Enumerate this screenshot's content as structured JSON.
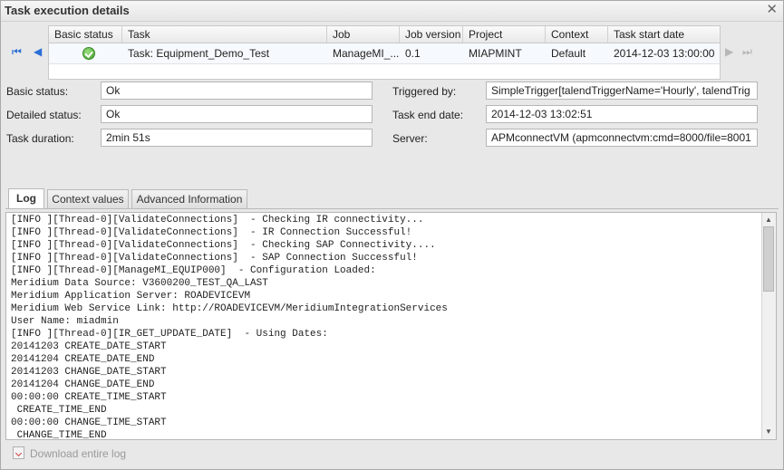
{
  "window": {
    "title": "Task execution details",
    "close_glyph": "✕"
  },
  "grid": {
    "headers": [
      "Basic status",
      "Task",
      "Job",
      "Job version",
      "Project",
      "Context",
      "Task start date"
    ],
    "row": {
      "status_icon": "green-check-icon",
      "task": "Task: Equipment_Demo_Test",
      "job": "ManageMI_...",
      "job_version": "0.1",
      "project": "MIAPMINT",
      "context": "Default",
      "start_date": "2014-12-03 13:00:00"
    },
    "nav": {
      "first": "⏮",
      "prev": "◀",
      "next": "▶",
      "last": "⏭"
    }
  },
  "details": {
    "basic_status_label": "Basic status:",
    "basic_status_value": "Ok",
    "detailed_status_label": "Detailed status:",
    "detailed_status_value": "Ok",
    "task_duration_label": "Task duration:",
    "task_duration_value": "2min 51s",
    "triggered_by_label": "Triggered by:",
    "triggered_by_value": "SimpleTrigger[talendTriggerName='Hourly', talendTrig",
    "task_end_date_label": "Task end date:",
    "task_end_date_value": "2014-12-03 13:02:51",
    "server_label": "Server:",
    "server_value": "APMconnectVM (apmconnectvm:cmd=8000/file=8001"
  },
  "tabs": {
    "log": "Log",
    "context_values": "Context values",
    "advanced": "Advanced Information"
  },
  "log_text": "[INFO ][Thread-0][ValidateConnections]  - Checking IR connectivity...\n[INFO ][Thread-0][ValidateConnections]  - IR Connection Successful!\n[INFO ][Thread-0][ValidateConnections]  - Checking SAP Connectivity....\n[INFO ][Thread-0][ValidateConnections]  - SAP Connection Successful!\n[INFO ][Thread-0][ManageMI_EQUIP000]  - Configuration Loaded:\nMeridium Data Source: V3600200_TEST_QA_LAST\nMeridium Application Server: ROADEVICEVM\nMeridium Web Service Link: http://ROADEVICEVM/MeridiumIntegrationServices\nUser Name: miadmin\n[INFO ][Thread-0][IR_GET_UPDATE_DATE]  - Using Dates:\n20141203 CREATE_DATE_START\n20141204 CREATE_DATE_END\n20141203 CHANGE_DATE_START\n20141204 CHANGE_DATE_END\n00:00:00 CREATE_TIME_START\n CREATE_TIME_END\n00:00:00 CHANGE_TIME_START\n CHANGE_TIME_END",
  "footer": {
    "download_label": "Download entire log"
  },
  "colors": {
    "accent_blue": "#2a6fd6",
    "ok_green": "#3f9d2b"
  }
}
